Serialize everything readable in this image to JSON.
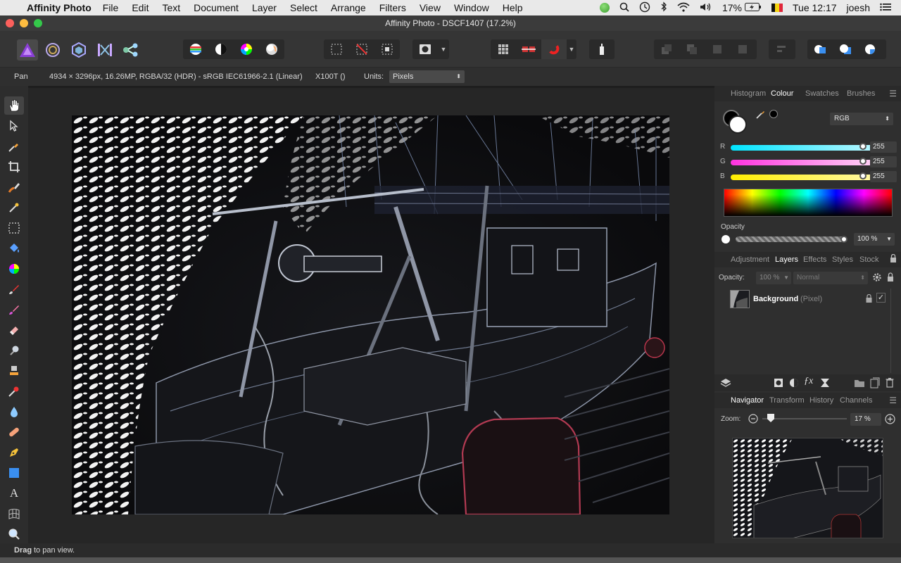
{
  "menubar": {
    "app_name": "Affinity Photo",
    "items": [
      "File",
      "Edit",
      "Text",
      "Document",
      "Layer",
      "Select",
      "Arrange",
      "Filters",
      "View",
      "Window",
      "Help"
    ],
    "battery": "17%",
    "clock": "Tue 12:17",
    "user": "joesh"
  },
  "window": {
    "title": "Affinity Photo - DSCF1407 (17.2%)"
  },
  "context": {
    "tool": "Pan",
    "doc_info": "4934 × 3296px, 16.26MP, RGBA/32 (HDR) - sRGB IEC61966-2.1 (Linear)",
    "camera": "X100T ()",
    "units_label": "Units:",
    "units_value": "Pixels"
  },
  "colour_panel": {
    "tabs": [
      "Histogram",
      "Colour",
      "Swatches",
      "Brushes"
    ],
    "active_tab": "Colour",
    "model": "RGB",
    "channels": [
      {
        "label": "R",
        "value": "255",
        "from": "#00e5ff",
        "to": "#bdf7ff"
      },
      {
        "label": "G",
        "value": "255",
        "from": "#ff33e0",
        "to": "#ffd6f6"
      },
      {
        "label": "B",
        "value": "255",
        "from": "#ffee00",
        "to": "#fff8a8"
      }
    ],
    "opacity_label": "Opacity",
    "opacity_value": "100 %"
  },
  "layers_panel": {
    "tabs": [
      "Adjustment",
      "Layers",
      "Effects",
      "Styles",
      "Stock"
    ],
    "active_tab": "Layers",
    "opacity_label": "Opacity:",
    "opacity_value": "100 %",
    "blend_mode": "Normal",
    "layers": [
      {
        "name": "Background",
        "type": "(Pixel)"
      }
    ]
  },
  "navigator_panel": {
    "tabs": [
      "Navigator",
      "Transform",
      "History",
      "Channels"
    ],
    "active_tab": "Navigator",
    "zoom_label": "Zoom:",
    "zoom_value": "17 %"
  },
  "status": {
    "bold": "Drag",
    "text": " to pan view."
  }
}
